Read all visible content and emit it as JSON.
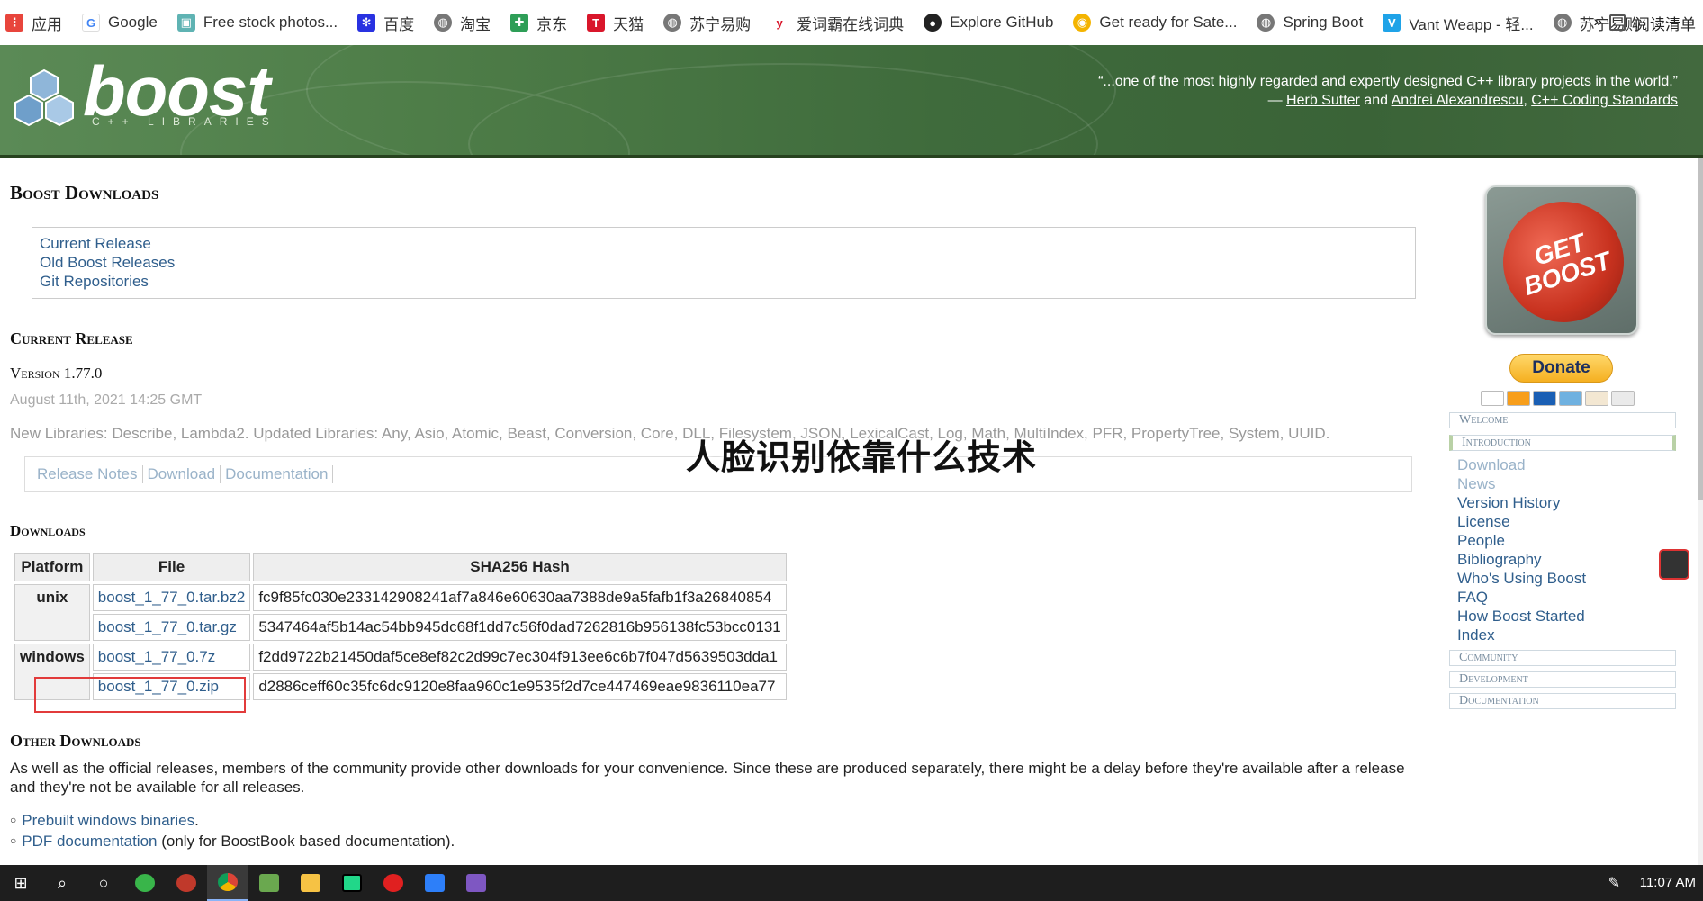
{
  "bookmarks": {
    "items": [
      {
        "label": "应用",
        "icon": "apps-grid-icon",
        "color": "#e8453c"
      },
      {
        "label": "Google",
        "icon": "google-icon",
        "color": "#4285f4"
      },
      {
        "label": "Free stock photos...",
        "icon": "stock-photos-icon",
        "color": "#5fb3b3"
      },
      {
        "label": "百度",
        "icon": "baidu-paw-icon",
        "color": "#2932e1"
      },
      {
        "label": "淘宝",
        "icon": "globe-icon",
        "color": "#777777"
      },
      {
        "label": "京东",
        "icon": "jd-icon",
        "color": "#2e9e57"
      },
      {
        "label": "天猫",
        "icon": "tmall-icon",
        "color": "#d9162b"
      },
      {
        "label": "苏宁易购",
        "icon": "globe-icon",
        "color": "#777777"
      },
      {
        "label": "爱词霸在线词典",
        "icon": "iciba-icon",
        "color": "#d9162b"
      },
      {
        "label": "Explore GitHub",
        "icon": "github-icon",
        "color": "#222222"
      },
      {
        "label": "Get ready for Sate...",
        "icon": "chrome-icon",
        "color": "#f4b400"
      },
      {
        "label": "Spring Boot",
        "icon": "globe-icon",
        "color": "#777777"
      },
      {
        "label": "Vant Weapp - 轻...",
        "icon": "vant-icon",
        "color": "#1fa3e8"
      },
      {
        "label": "苏宁易购",
        "icon": "globe-icon",
        "color": "#777777"
      }
    ],
    "more": "»",
    "reading_list": "阅读清单"
  },
  "banner": {
    "logo_text": "boost",
    "logo_sub": "C++ LIBRARIES",
    "quote_line1": "“...one of the most highly regarded and expertly designed C++ library projects in the world.”",
    "quote_dash": "— ",
    "quote_author1": "Herb Sutter",
    "quote_and": " and ",
    "quote_author2": "Andrei Alexandrescu",
    "quote_comma": ", ",
    "quote_book": "C++ Coding Standards"
  },
  "main": {
    "title": "Boost Downloads",
    "toc": [
      "Current Release",
      "Old Boost Releases",
      "Git Repositories"
    ],
    "current_release_heading": "Current Release",
    "version": "Version 1.77.0",
    "date": "August 11th, 2021 14:25 GMT",
    "libraries": "New Libraries: Describe, Lambda2. Updated Libraries: Any, Asio, Atomic, Beast, Conversion, Core, DLL, Filesystem, JSON, LexicalCast, Log, Math, MultiIndex, PFR, PropertyTree, System, UUID.",
    "release_nav": [
      "Release Notes",
      "Download",
      "Documentation"
    ],
    "downloads_heading": "Downloads",
    "table": {
      "headers": [
        "Platform",
        "File",
        "SHA256 Hash"
      ],
      "rows": [
        {
          "platform": "unix",
          "file": "boost_1_77_0.tar.bz2",
          "hash": "fc9f85fc030e233142908241af7a846e60630aa7388de9a5fafb1f3a26840854"
        },
        {
          "platform": "",
          "file": "boost_1_77_0.tar.gz",
          "hash": "5347464af5b14ac54bb945dc68f1dd7c56f0dad7262816b956138fc53bcc0131"
        },
        {
          "platform": "windows",
          "file": "boost_1_77_0.7z",
          "hash": "f2dd9722b21450daf5ce8ef82c2d99c7ec304f913ee6c6b7f047d5639503dda1"
        },
        {
          "platform": "",
          "file": "boost_1_77_0.zip",
          "hash": "d2886ceff60c35fc6dc9120e8faa960c1e9535f2d7ce447469eae9836110ea77"
        }
      ]
    },
    "other_heading": "Other Downloads",
    "other_text": "As well as the official releases, members of the community provide other downloads for your convenience. Since these are produced separately, there might be a delay before they're available after a release and they're not be available for all releases.",
    "other_items": [
      {
        "link": "Prebuilt windows binaries",
        "suffix": "."
      },
      {
        "link": "PDF documentation",
        "suffix": " (only for BoostBook based documentation)."
      }
    ]
  },
  "watermark": "人脸识别依靠什么技术",
  "sidebar": {
    "get_boost": "GET BOOST",
    "donate": "Donate",
    "sections": {
      "welcome": "Welcome",
      "introduction": "Introduction",
      "community": "Community",
      "development": "Development",
      "documentation": "Documentation"
    },
    "intro_links": [
      "Download",
      "News",
      "Version History",
      "License",
      "People",
      "Bibliography",
      "Who's Using Boost",
      "FAQ",
      "How Boost Started",
      "Index"
    ]
  },
  "taskbar": {
    "time": "11:07 AM",
    "apps": [
      "windows-start-icon",
      "search-icon",
      "task-view-icon",
      "app-green-icon",
      "app-netease-icon",
      "chrome-icon",
      "app-folder-green-icon",
      "file-explorer-icon",
      "pycharm-icon",
      "app-red-icon",
      "app-blue-icon",
      "visual-studio-icon"
    ]
  }
}
